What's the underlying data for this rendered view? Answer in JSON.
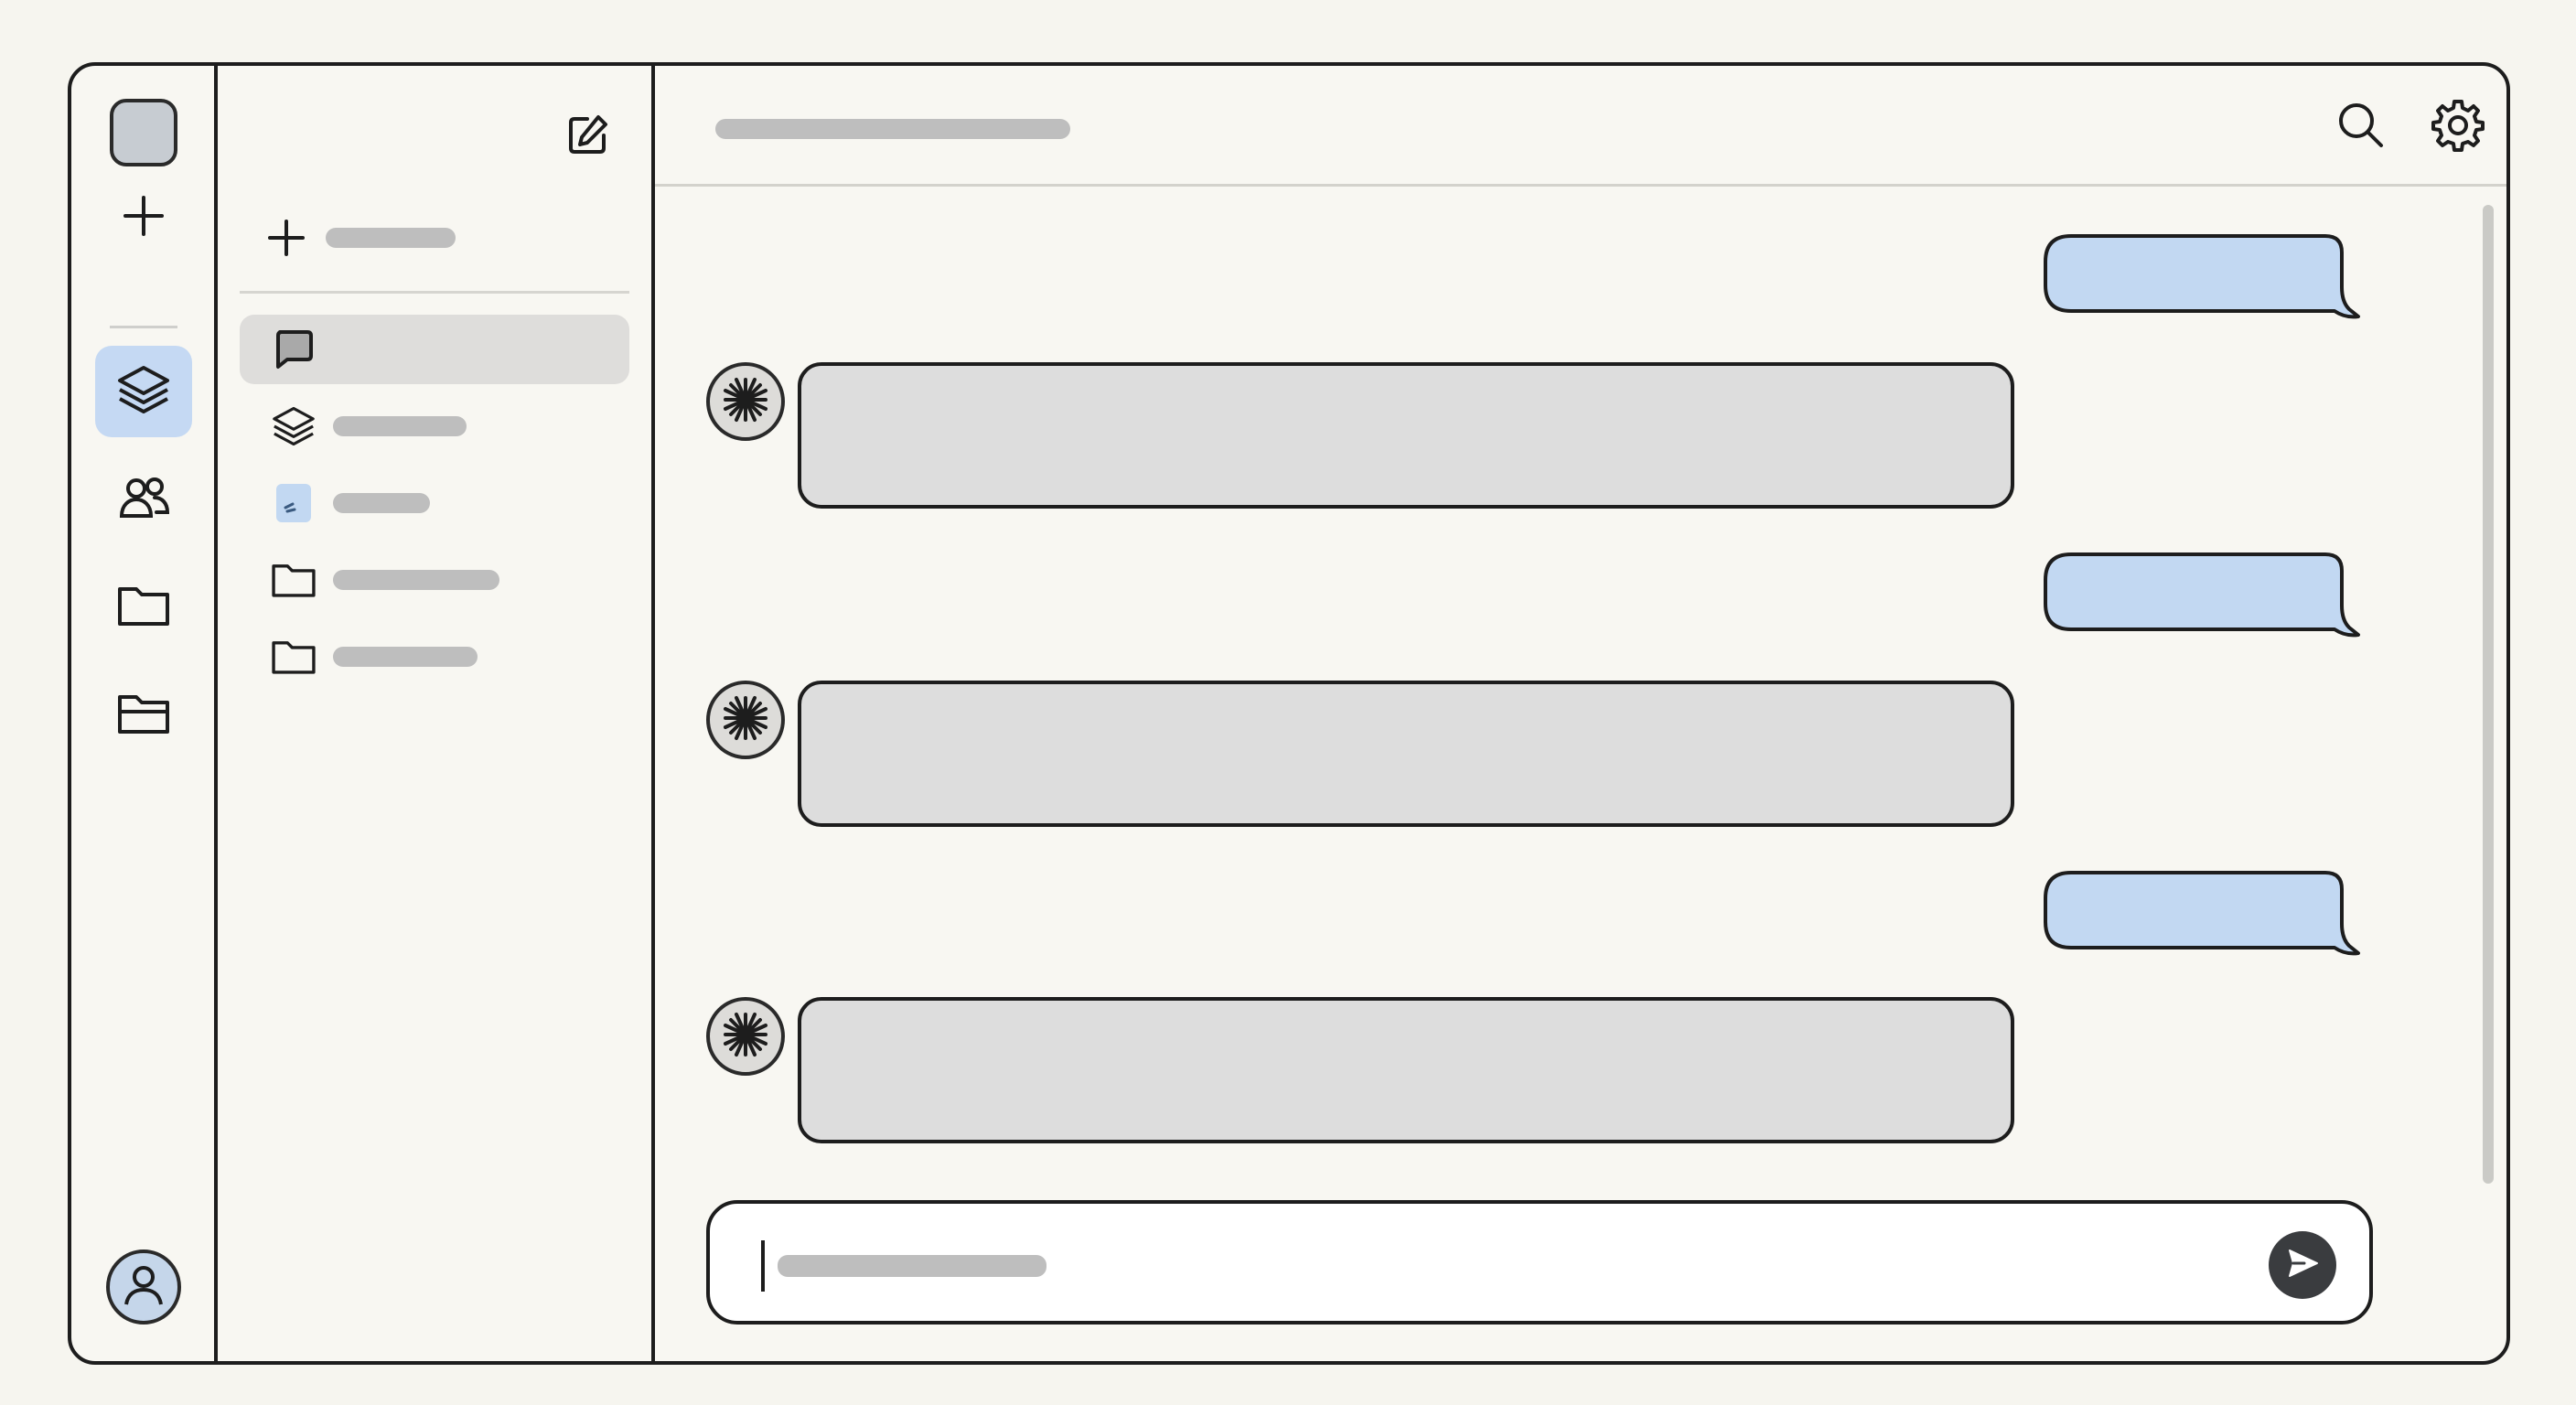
{
  "rail": {
    "icons": [
      "logo",
      "plus-icon",
      "layers-icon",
      "people-icon",
      "folder-icon",
      "folder-open-icon",
      "user-avatar-icon"
    ],
    "active_item": "layers-icon"
  },
  "panel": {
    "compose_icon": "edit-icon",
    "new_item_icon": "plus-icon",
    "items": [
      {
        "icon": "chat-bubble-icon",
        "selected": true
      },
      {
        "icon": "layers-icon",
        "selected": false
      },
      {
        "icon": "document-icon",
        "selected": false
      },
      {
        "icon": "folder-icon",
        "selected": false
      },
      {
        "icon": "folder-icon",
        "selected": false
      }
    ]
  },
  "topbar": {
    "icons": [
      "search-icon",
      "settings-gear-icon"
    ]
  },
  "messages": [
    {
      "role": "user"
    },
    {
      "role": "assistant",
      "avatar_icon": "asterisk-burst-icon"
    },
    {
      "role": "user"
    },
    {
      "role": "assistant",
      "avatar_icon": "asterisk-burst-icon"
    },
    {
      "role": "user"
    },
    {
      "role": "assistant",
      "avatar_icon": "asterisk-burst-icon"
    }
  ],
  "composer": {
    "send_icon": "send-arrow-icon"
  },
  "colors": {
    "background": "#f6f5ef",
    "outline": "#1d1d1d",
    "accent_blue": "#c5d9f3",
    "user_bubble": "#c2d8f2",
    "assistant_bubble": "#dddddd",
    "skeleton": "#bebebe",
    "send_button": "#3a3c3f"
  }
}
